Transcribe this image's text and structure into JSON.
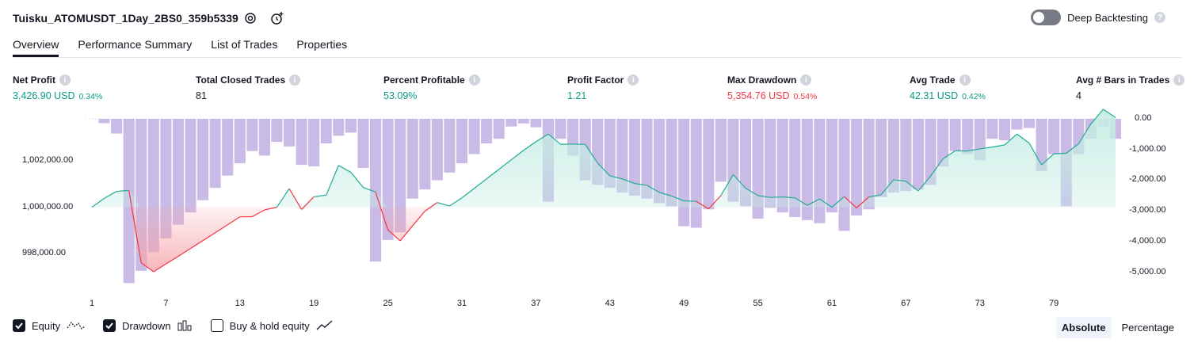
{
  "header": {
    "title": "Tuisku_ATOMUSDT_1Day_2BS0_359b5339",
    "deep_backtesting_label": "Deep Backtesting",
    "deep_backtesting_on": false
  },
  "tabs": [
    "Overview",
    "Performance Summary",
    "List of Trades",
    "Properties"
  ],
  "active_tab": "Overview",
  "metrics": [
    {
      "label": "Net Profit",
      "value": "3,426.90 USD",
      "percent": "0.34%",
      "color": "#089981"
    },
    {
      "label": "Total Closed Trades",
      "value": "81",
      "percent": "",
      "color": "#131722"
    },
    {
      "label": "Percent Profitable",
      "value": "53.09%",
      "percent": "",
      "color": "#089981"
    },
    {
      "label": "Profit Factor",
      "value": "1.21",
      "percent": "",
      "color": "#089981"
    },
    {
      "label": "Max Drawdown",
      "value": "5,354.76 USD",
      "percent": "0.54%",
      "color": "#f23645"
    },
    {
      "label": "Avg Trade",
      "value": "42.31 USD",
      "percent": "0.42%",
      "color": "#089981"
    },
    {
      "label": "Avg # Bars in Trades",
      "value": "4",
      "percent": "",
      "color": "#131722"
    }
  ],
  "chart_data": {
    "type": "line",
    "x_ticks": [
      "1",
      "7",
      "13",
      "19",
      "25",
      "31",
      "37",
      "43",
      "49",
      "55",
      "61",
      "67",
      "73",
      "79"
    ],
    "left_axis_ticks": [
      "1,002,000.00",
      "1,000,000.00",
      "998,000.00"
    ],
    "right_axis_ticks": [
      "0.00",
      "-1,000.00",
      "-2,000.00",
      "-3,000.00",
      "-4,000.00",
      "-5,000.00"
    ],
    "baseline_equity": 1000000,
    "equity": [
      1000000,
      1000380,
      1000680,
      1000720,
      997600,
      997220,
      997550,
      997880,
      998220,
      998560,
      998900,
      999240,
      999580,
      999590,
      999880,
      1000000,
      1000800,
      999900,
      1000450,
      1000520,
      1001800,
      1001500,
      1000850,
      1000650,
      999020,
      998550,
      999200,
      999830,
      1000200,
      1000050,
      1000400,
      1000810,
      1001220,
      1001630,
      1002040,
      1002450,
      1002820,
      1003150,
      1002710,
      1002720,
      1002700,
      1001900,
      1001350,
      1001220,
      1001020,
      1000940,
      1000640,
      1000480,
      1000270,
      1000250,
      999930,
      1000500,
      1001400,
      1000820,
      1000500,
      1000420,
      1000440,
      1000400,
      1000080,
      1000350,
      1000000,
      1000460,
      999970,
      1000440,
      1000540,
      1001180,
      1001120,
      1000700,
      1001330,
      1002080,
      1002430,
      1002420,
      1002510,
      1002590,
      1002680,
      1003150,
      1002760,
      1001820,
      1002300,
      1002320,
      1002730,
      1003580,
      1004220,
      1003860
    ],
    "drawdown": [
      0,
      -141,
      -480,
      -5350,
      -4950,
      -4350,
      -3900,
      -3450,
      -3050,
      -2650,
      -2250,
      -1850,
      -1450,
      -1050,
      -1200,
      -750,
      -900,
      -1500,
      -1550,
      -800,
      -550,
      -450,
      -1600,
      -4650,
      -3950,
      -3700,
      -2600,
      -2300,
      -2000,
      -1750,
      -1450,
      -1150,
      -800,
      -650,
      -250,
      -150,
      -275,
      -2700,
      -650,
      -1200,
      -2000,
      -2150,
      -2250,
      -2400,
      -2500,
      -2600,
      -2750,
      -2850,
      -3500,
      -3550,
      -2950,
      -2050,
      -2700,
      -2850,
      -3250,
      -2900,
      -3050,
      -3200,
      -3300,
      -3400,
      -3050,
      -3650,
      -3150,
      -2950,
      -2550,
      -2400,
      -2350,
      -2300,
      -2150,
      -1550,
      -1050,
      -1150,
      -1350,
      -650,
      -700,
      -350,
      -300,
      -1700,
      -1150,
      -2850,
      -1150,
      -650,
      -250,
      -650
    ],
    "legend": {
      "equity": {
        "label": "Equity",
        "checked": true
      },
      "drawdown": {
        "label": "Drawdown",
        "checked": true
      },
      "buy_hold": {
        "label": "Buy & hold equity",
        "checked": false
      }
    },
    "colors": {
      "equity_line": "#22ab94",
      "equity_drawdown_line": "#f23645",
      "drawdown_bar": "#b39ddb",
      "equity_fill": "#c5ede4",
      "drawdown_fill": "#f7a3a9"
    }
  },
  "view_toggle": {
    "absolute": "Absolute",
    "percentage": "Percentage",
    "active": "absolute"
  }
}
